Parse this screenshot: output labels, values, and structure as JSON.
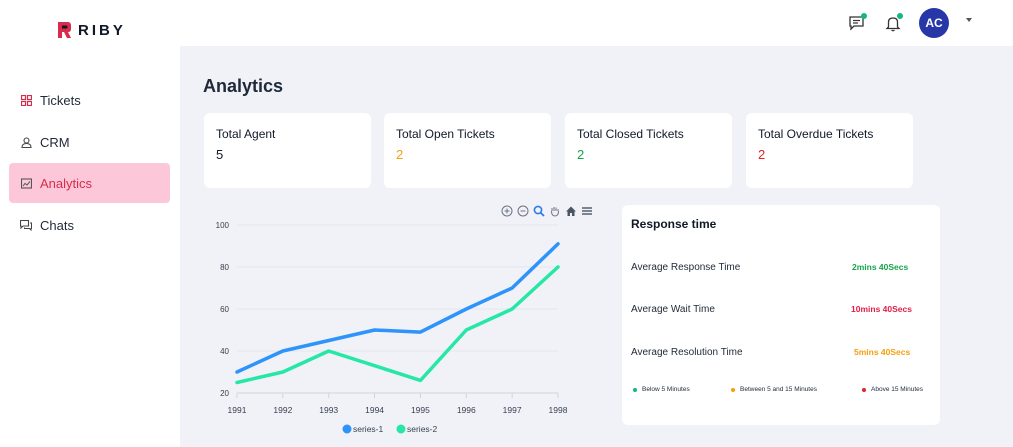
{
  "brand": {
    "name": "RIBY",
    "accent": "#d92b4b"
  },
  "header": {
    "avatar_initials": "AC",
    "icons": [
      "chat-notification-icon",
      "bell-icon",
      "chevron-down-icon"
    ]
  },
  "sidebar": {
    "items": [
      {
        "label": "Tickets",
        "icon": "tickets-icon"
      },
      {
        "label": "CRM",
        "icon": "user-icon"
      },
      {
        "label": "Analytics",
        "icon": "analytics-icon",
        "active": true
      },
      {
        "label": "Chats",
        "icon": "chats-icon"
      }
    ]
  },
  "main": {
    "title": "Analytics",
    "stats": [
      {
        "label": "Total Agent",
        "value": "5",
        "color": "#111827"
      },
      {
        "label": "Total Open Tickets",
        "value": "2",
        "color": "#f59e0b"
      },
      {
        "label": "Total Closed Tickets",
        "value": "2",
        "color": "#16a34a"
      },
      {
        "label": "Total Overdue Tickets",
        "value": "2",
        "color": "#dc2626"
      }
    ],
    "response": {
      "title": "Response time",
      "rows": [
        {
          "label": "Average Response Time",
          "value": "2mins 40Secs",
          "color": "#16a34a"
        },
        {
          "label": "Average Wait Time",
          "value": "10mins 40Secs",
          "color": "#e11d48"
        },
        {
          "label": "Average Resolution Time",
          "value": "5mins 40Secs",
          "color": "#f59e0b"
        }
      ],
      "legend": [
        {
          "label": "Below 5 Minutes",
          "color": "#10b981"
        },
        {
          "label": "Between 5 and 15 Minutes",
          "color": "#f59e0b"
        },
        {
          "label": "Above 15 Minutes",
          "color": "#dc2626"
        }
      ]
    }
  },
  "chart_data": {
    "type": "line",
    "x": [
      1991,
      1992,
      1993,
      1994,
      1995,
      1996,
      1997,
      1998
    ],
    "series": [
      {
        "name": "series-1",
        "values": [
          30,
          40,
          45,
          50,
          49,
          60,
          70,
          91
        ],
        "color": "#2e93fa"
      },
      {
        "name": "series-2",
        "values": [
          25,
          30,
          40,
          33,
          26,
          50,
          60,
          80
        ],
        "color": "#26e7a6"
      }
    ],
    "ylim": [
      20,
      100
    ],
    "yticks": [
      20,
      40,
      60,
      80,
      100
    ],
    "grid": true,
    "legend": "bottom",
    "toolbar_icons": [
      "zoom-in-icon",
      "zoom-out-icon",
      "search-icon",
      "pan-icon",
      "home-icon",
      "menu-icon"
    ]
  }
}
